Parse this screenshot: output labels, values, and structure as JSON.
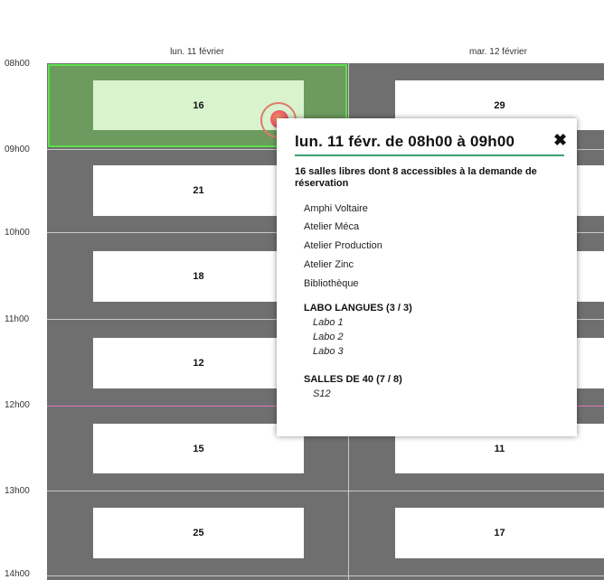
{
  "calendar": {
    "times": [
      "08h00",
      "09h00",
      "10h00",
      "11h00",
      "12h00",
      "13h00",
      "14h00"
    ],
    "days": [
      {
        "label": "lun. 11 février",
        "slots": [
          "16",
          "21",
          "18",
          "12",
          "15",
          "25"
        ]
      },
      {
        "label": "mar. 12 février",
        "slots": [
          "29",
          "",
          "",
          "",
          "11",
          "17"
        ]
      }
    ]
  },
  "popup": {
    "title": "lun. 11 févr. de 08h00 à 09h00",
    "close_icon": "✖",
    "summary": "16 salles libres dont 8 accessibles à la demande de réservation",
    "rooms": [
      "Amphi Voltaire",
      "Atelier Méca",
      "Atelier Production",
      "Atelier Zinc",
      "Bibliothèque"
    ],
    "groups": [
      {
        "name": "LABO LANGUES (3 / 3)",
        "rooms": [
          "Labo 1",
          "Labo 2",
          "Labo 3"
        ]
      },
      {
        "name": "SALLES DE 40 (7 / 8)",
        "rooms": [
          "S12"
        ]
      }
    ]
  },
  "colors": {
    "grid_background": "#6f6f6f",
    "selected_fill": "#6d9a5e",
    "selected_border": "#59e04b",
    "current_time_line": "#e276c8",
    "popup_underline": "#3aa06f"
  }
}
